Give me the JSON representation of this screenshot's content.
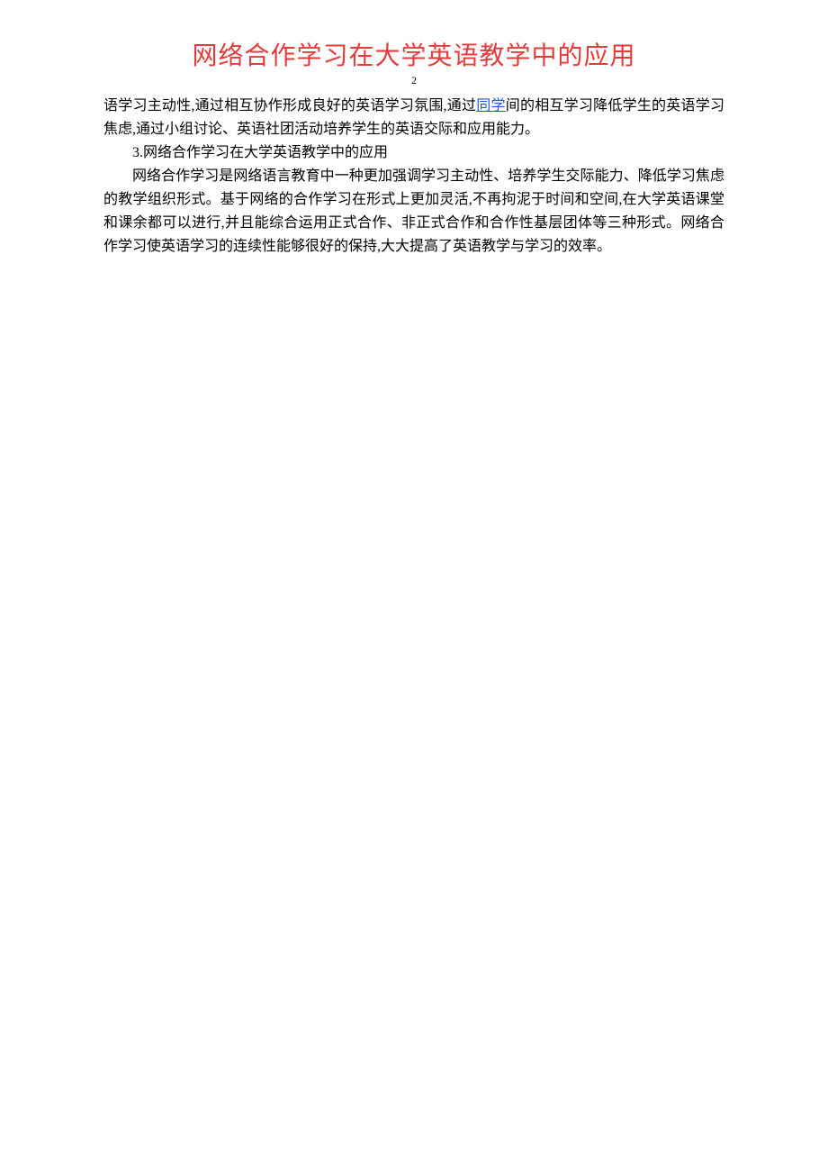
{
  "title": "网络合作学习在大学英语教学中的应用",
  "page_number": "2",
  "para1_before_link": "语学习主动性,通过相互协作形成良好的英语学习氛围,通过",
  "link_text": "同学",
  "para1_after_link": "间的相互学习降低学生的英语学习焦虑,通过小组讨论、英语社团活动培养学生的英语交际和应用能力。",
  "heading2": "3.网络合作学习在大学英语教学中的应用",
  "para2": "网络合作学习是网络语言教育中一种更加强调学习主动性、培养学生交际能力、降低学习焦虑的教学组织形式。基于网络的合作学习在形式上更加灵活,不再拘泥于时间和空间,在大学英语课堂和课余都可以进行,并且能综合运用正式合作、非正式合作和合作性基层团体等三种形式。网络合作学习使英语学习的连续性能够很好的保持,大大提高了英语教学与学习的效率。"
}
